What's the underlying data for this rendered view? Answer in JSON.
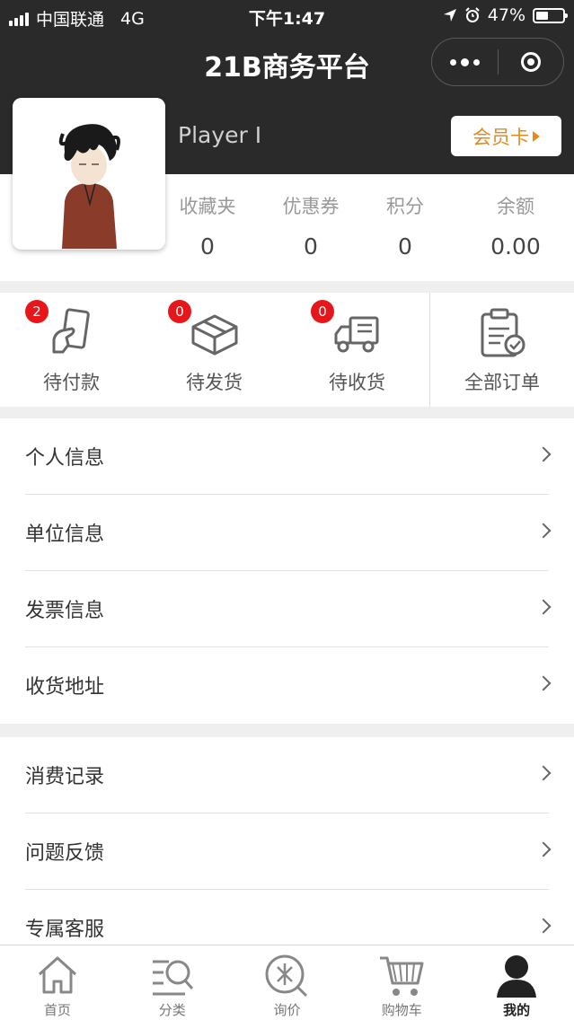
{
  "status_bar": {
    "carrier": "中国联通",
    "network": "4G",
    "time": "下午1:47",
    "battery": "47%",
    "battery_level": 0.47
  },
  "nav": {
    "title": "21B商务平台"
  },
  "profile": {
    "username": "Player I",
    "member_card_label": "会员卡"
  },
  "stats": [
    {
      "label": "收藏夹",
      "value": "0"
    },
    {
      "label": "优惠券",
      "value": "0"
    },
    {
      "label": "积分",
      "value": "0"
    },
    {
      "label": "余额",
      "value": "0.00"
    }
  ],
  "orders": [
    {
      "label": "待付款",
      "badge": "2",
      "icon": "payment-icon"
    },
    {
      "label": "待发货",
      "badge": "0",
      "icon": "box-icon"
    },
    {
      "label": "待收货",
      "badge": "0",
      "icon": "truck-icon"
    },
    {
      "label": "全部订单",
      "icon": "clipboard-icon"
    }
  ],
  "menu_group_1": [
    "个人信息",
    "单位信息",
    "发票信息",
    "收货地址"
  ],
  "menu_group_2": [
    "消费记录",
    "问题反馈",
    "专属客服"
  ],
  "tabbar": [
    {
      "label": "首页",
      "icon": "home-icon"
    },
    {
      "label": "分类",
      "icon": "category-search-icon"
    },
    {
      "label": "询价",
      "icon": "inquiry-icon"
    },
    {
      "label": "购物车",
      "icon": "cart-icon"
    },
    {
      "label": "我的",
      "icon": "user-icon",
      "active": true
    }
  ],
  "colors": {
    "header_bg": "#2a2a2a",
    "accent": "#e38c1e",
    "badge": "#e6161a"
  }
}
